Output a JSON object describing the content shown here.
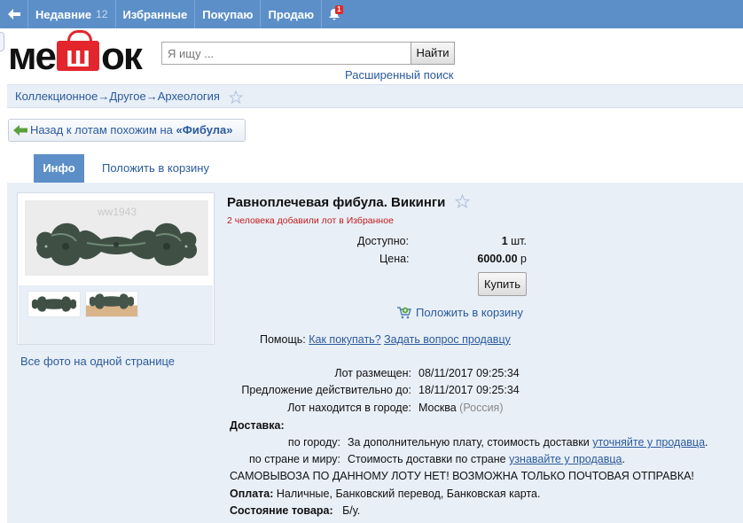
{
  "nav": {
    "recent_label": "Недавние",
    "recent_count": "12",
    "favorites_label": "Избранные",
    "buying_label": "Покупаю",
    "selling_label": "Продаю",
    "notifications_count": "1"
  },
  "logo": {
    "text": "Мешок"
  },
  "search": {
    "placeholder": "Я ищу ...",
    "button_label": "Найти",
    "advanced_label": "Расширенный поиск"
  },
  "breadcrumb": {
    "items": [
      "Коллекционное",
      "Другое",
      "Археология"
    ],
    "separator": "→"
  },
  "back_button": {
    "prefix": "Назад к лотам похожим на ",
    "query": "«Фибула»"
  },
  "tabs": {
    "info": "Инфо",
    "add_to_cart": "Положить в корзину"
  },
  "photo": {
    "watermark": "ww1943",
    "all_photos_label": "Все фото на одной странице"
  },
  "lot": {
    "title": "Равноплечевая фибула. Викинги",
    "favorites_note": "2 человека добавили лот в Избранное",
    "available_label": "Доступно:",
    "available_value": "1",
    "available_unit": "шт.",
    "price_label": "Цена:",
    "price_value": "6000.00",
    "price_currency": "р",
    "buy_label": "Купить",
    "cart_label": "Положить в корзину",
    "help_label": "Помощь:",
    "help_how_to_buy": "Как покупать?",
    "help_ask_seller": "Задать вопрос продавцу",
    "placed_label": "Лот размещен:",
    "placed_value": "08/11/2017 09:25:34",
    "valid_label": "Предложение действительно до:",
    "valid_value": "18/11/2017 09:25:34",
    "city_label": "Лот находится в городе:",
    "city_value": "Москва",
    "country_value": "(Россия)"
  },
  "delivery": {
    "heading": "Доставка:",
    "city_label": "по городу:",
    "city_text": "За дополнительную плату, стоимость доставки",
    "city_link": "уточняйте у продавца",
    "world_label": "по стране и миру:",
    "world_text": "Стоимость доставки по стране",
    "world_link": "узнавайте у продавца",
    "notice": "САМОВЫВОЗА ПО ДАННОМУ ЛОТУ НЕТ! ВОЗМОЖНА ТОЛЬКО ПОЧТОВАЯ ОТПРАВКА!",
    "payment_label": "Оплата:",
    "payment_value": "Наличные, Банковский перевод, Банковская карта.",
    "condition_label": "Состояние товара:",
    "condition_value": "Б/у."
  },
  "colors": {
    "nav_bg": "#5c8fc8",
    "link": "#2a5a9c",
    "panel_bg": "#e9eff7",
    "logo_red": "#e3262d",
    "favorites_red": "#c11b1b"
  }
}
